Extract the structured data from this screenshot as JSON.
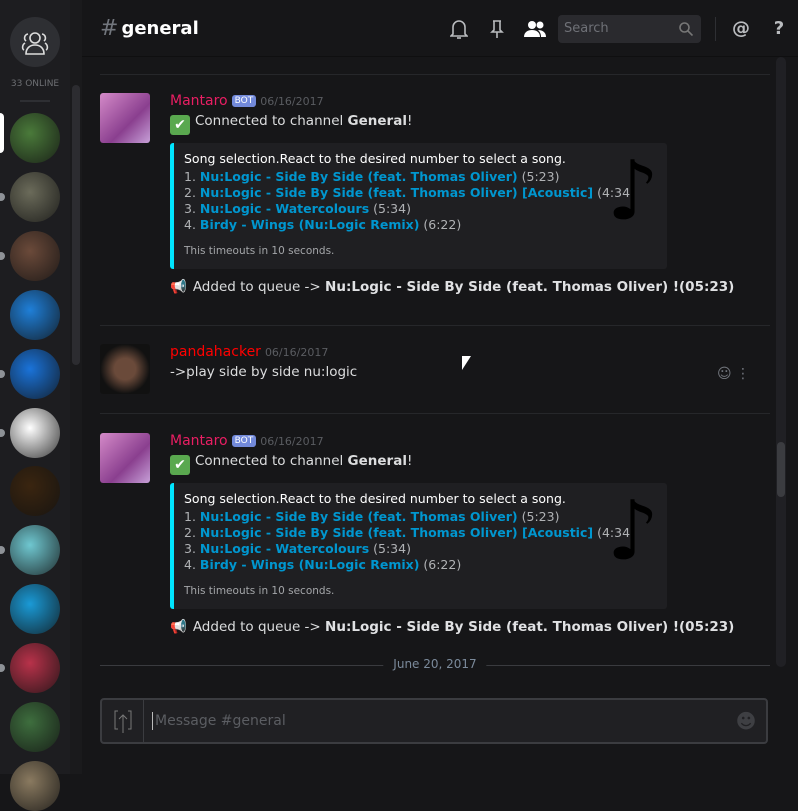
{
  "sidebar": {
    "online_count": "33 ONLINE",
    "servers": [
      {
        "c": "#4a7a3a",
        "dot": false,
        "sel": true
      },
      {
        "c": "#6b6b5a",
        "dot": true
      },
      {
        "c": "#6b4a3a",
        "dot": true
      },
      {
        "c": "#1f7fd8",
        "dot": false
      },
      {
        "c": "#1a73d9",
        "dot": true
      },
      {
        "c": "#ffffff",
        "dot": true
      },
      {
        "c": "#3a2510",
        "dot": false
      },
      {
        "c": "#6fc7d0",
        "dot": true
      },
      {
        "c": "#1a9ad6",
        "dot": false
      },
      {
        "c": "#b8324a",
        "dot": true
      },
      {
        "c": "#3e6e3e",
        "dot": false
      },
      {
        "c": "#8a7a60",
        "dot": false
      }
    ]
  },
  "header": {
    "hash": "#",
    "channel": "general",
    "search_placeholder": "Search"
  },
  "messages": [
    {
      "author": "Mantaro",
      "author_color": "#e91e63",
      "bot": "BOT",
      "timestamp": "06/16/2017",
      "connected_prefix": "Connected to channel ",
      "connected_channel": "General",
      "connected_suffix": "!",
      "embed": {
        "title": "Song selection.React to the desired number to select a song.",
        "items": [
          {
            "n": "1.",
            "title": "Nu:Logic - Side By Side (feat. Thomas Oliver)",
            "dur": "(5:23)"
          },
          {
            "n": "2.",
            "title": "Nu:Logic - Side By Side (feat. Thomas Oliver) [Acoustic]",
            "dur": "(4:34)"
          },
          {
            "n": "3.",
            "title": "Nu:Logic - Watercolours",
            "dur": "(5:34)"
          },
          {
            "n": "4.",
            "title": "Birdy - Wings (Nu:Logic Remix)",
            "dur": "(6:22)"
          }
        ],
        "footer": "This timeouts in 10 seconds."
      },
      "queue_prefix": "Added to queue -> ",
      "queue_song": "Nu:Logic - Side By Side (feat. Thomas Oliver) !(05:23)"
    },
    {
      "author": "pandahacker",
      "author_color": "#ff0000",
      "timestamp": "06/16/2017",
      "text": "->play side by side nu:logic"
    },
    {
      "author": "Mantaro",
      "author_color": "#e91e63",
      "bot": "BOT",
      "timestamp": "06/16/2017",
      "connected_prefix": "Connected to channel ",
      "connected_channel": "General",
      "connected_suffix": "!",
      "embed": {
        "title": "Song selection.React to the desired number to select a song.",
        "items": [
          {
            "n": "1.",
            "title": "Nu:Logic - Side By Side (feat. Thomas Oliver)",
            "dur": "(5:23)"
          },
          {
            "n": "2.",
            "title": "Nu:Logic - Side By Side (feat. Thomas Oliver) [Acoustic]",
            "dur": "(4:34)"
          },
          {
            "n": "3.",
            "title": "Nu:Logic - Watercolours",
            "dur": "(5:34)"
          },
          {
            "n": "4.",
            "title": "Birdy - Wings (Nu:Logic Remix)",
            "dur": "(6:22)"
          }
        ],
        "footer": "This timeouts in 10 seconds."
      },
      "queue_prefix": "Added to queue -> ",
      "queue_song": "Nu:Logic - Side By Side (feat. Thomas Oliver) !(05:23)"
    }
  ],
  "date_divider": "June 20, 2017",
  "composer": {
    "placeholder": "Message #general"
  },
  "colors": {
    "embed_border": "#00e5ff",
    "link": "#0096cf",
    "bot_badge": "#7289da"
  }
}
